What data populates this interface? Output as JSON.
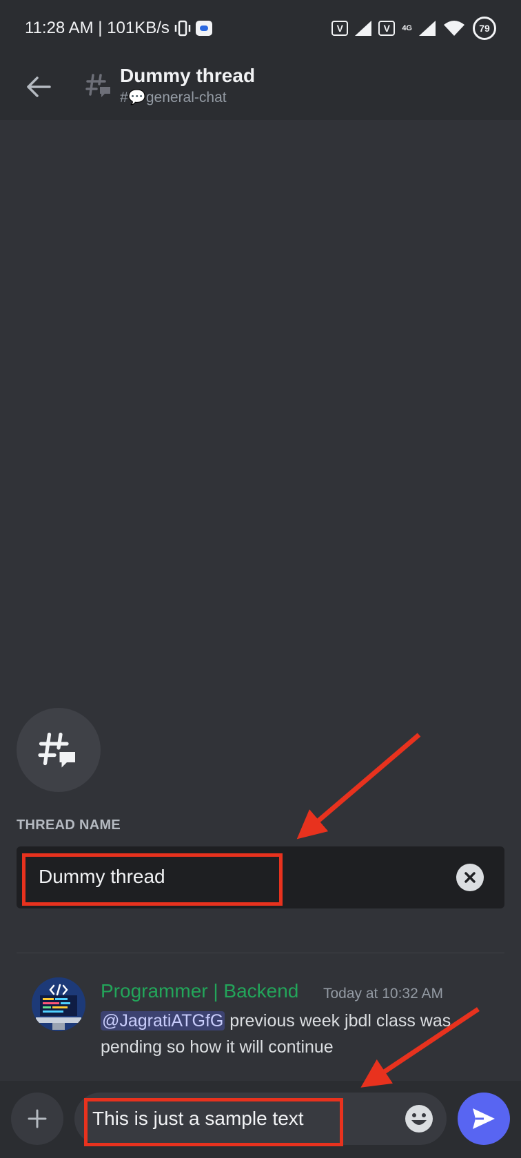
{
  "status_bar": {
    "time_speed": "11:28 AM | 101KB/s",
    "network_gen": "4G",
    "battery": "79",
    "volte_1": "V",
    "volte_2": "V"
  },
  "header": {
    "title": "Dummy thread",
    "channel_prefix": "#",
    "channel_name": "general-chat"
  },
  "thread_name": {
    "label": "THREAD NAME",
    "value": "Dummy thread"
  },
  "message": {
    "author": "Programmer | Backend",
    "timestamp": "Today at 10:32 AM",
    "mention": "@JagratiATGfG",
    "text": " previous week jbdl class was pending so how it will continue"
  },
  "composer": {
    "value": "This is just a sample text"
  },
  "colors": {
    "background": "#313338",
    "header": "#2b2d31",
    "author": "#23a55a",
    "send_button": "#5865f2",
    "annotation": "#e8321e"
  }
}
